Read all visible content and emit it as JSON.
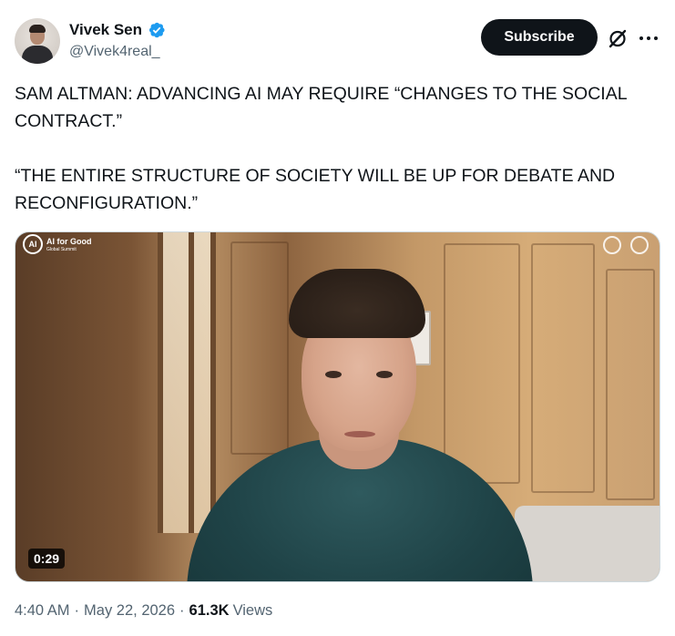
{
  "author": {
    "display_name": "Vivek Sen",
    "handle": "@Vivek4real_",
    "verified": true,
    "verified_color": "#1d9bf0"
  },
  "header_actions": {
    "subscribe_label": "Subscribe",
    "grok_icon": "grok-icon",
    "more_icon": "more-icon"
  },
  "tweet": {
    "paragraphs": [
      "SAM ALTMAN: ADVANCING AI MAY REQUIRE “CHANGES TO THE SOCIAL CONTRACT.”",
      "“THE ENTIRE STRUCTURE OF SOCIETY WILL BE UP FOR DEBATE AND RECONFIGURATION.”"
    ]
  },
  "video": {
    "duration": "0:29",
    "watermark_title": "AI for Good",
    "watermark_subtitle": "Global Summit"
  },
  "meta": {
    "time": "4:40 AM",
    "date": "May 22, 2026",
    "separator": "·",
    "views_count": "61.3K",
    "views_label": "Views"
  },
  "colors": {
    "text_primary": "#0f1419",
    "text_secondary": "#536471",
    "button_bg": "#0f1419"
  }
}
